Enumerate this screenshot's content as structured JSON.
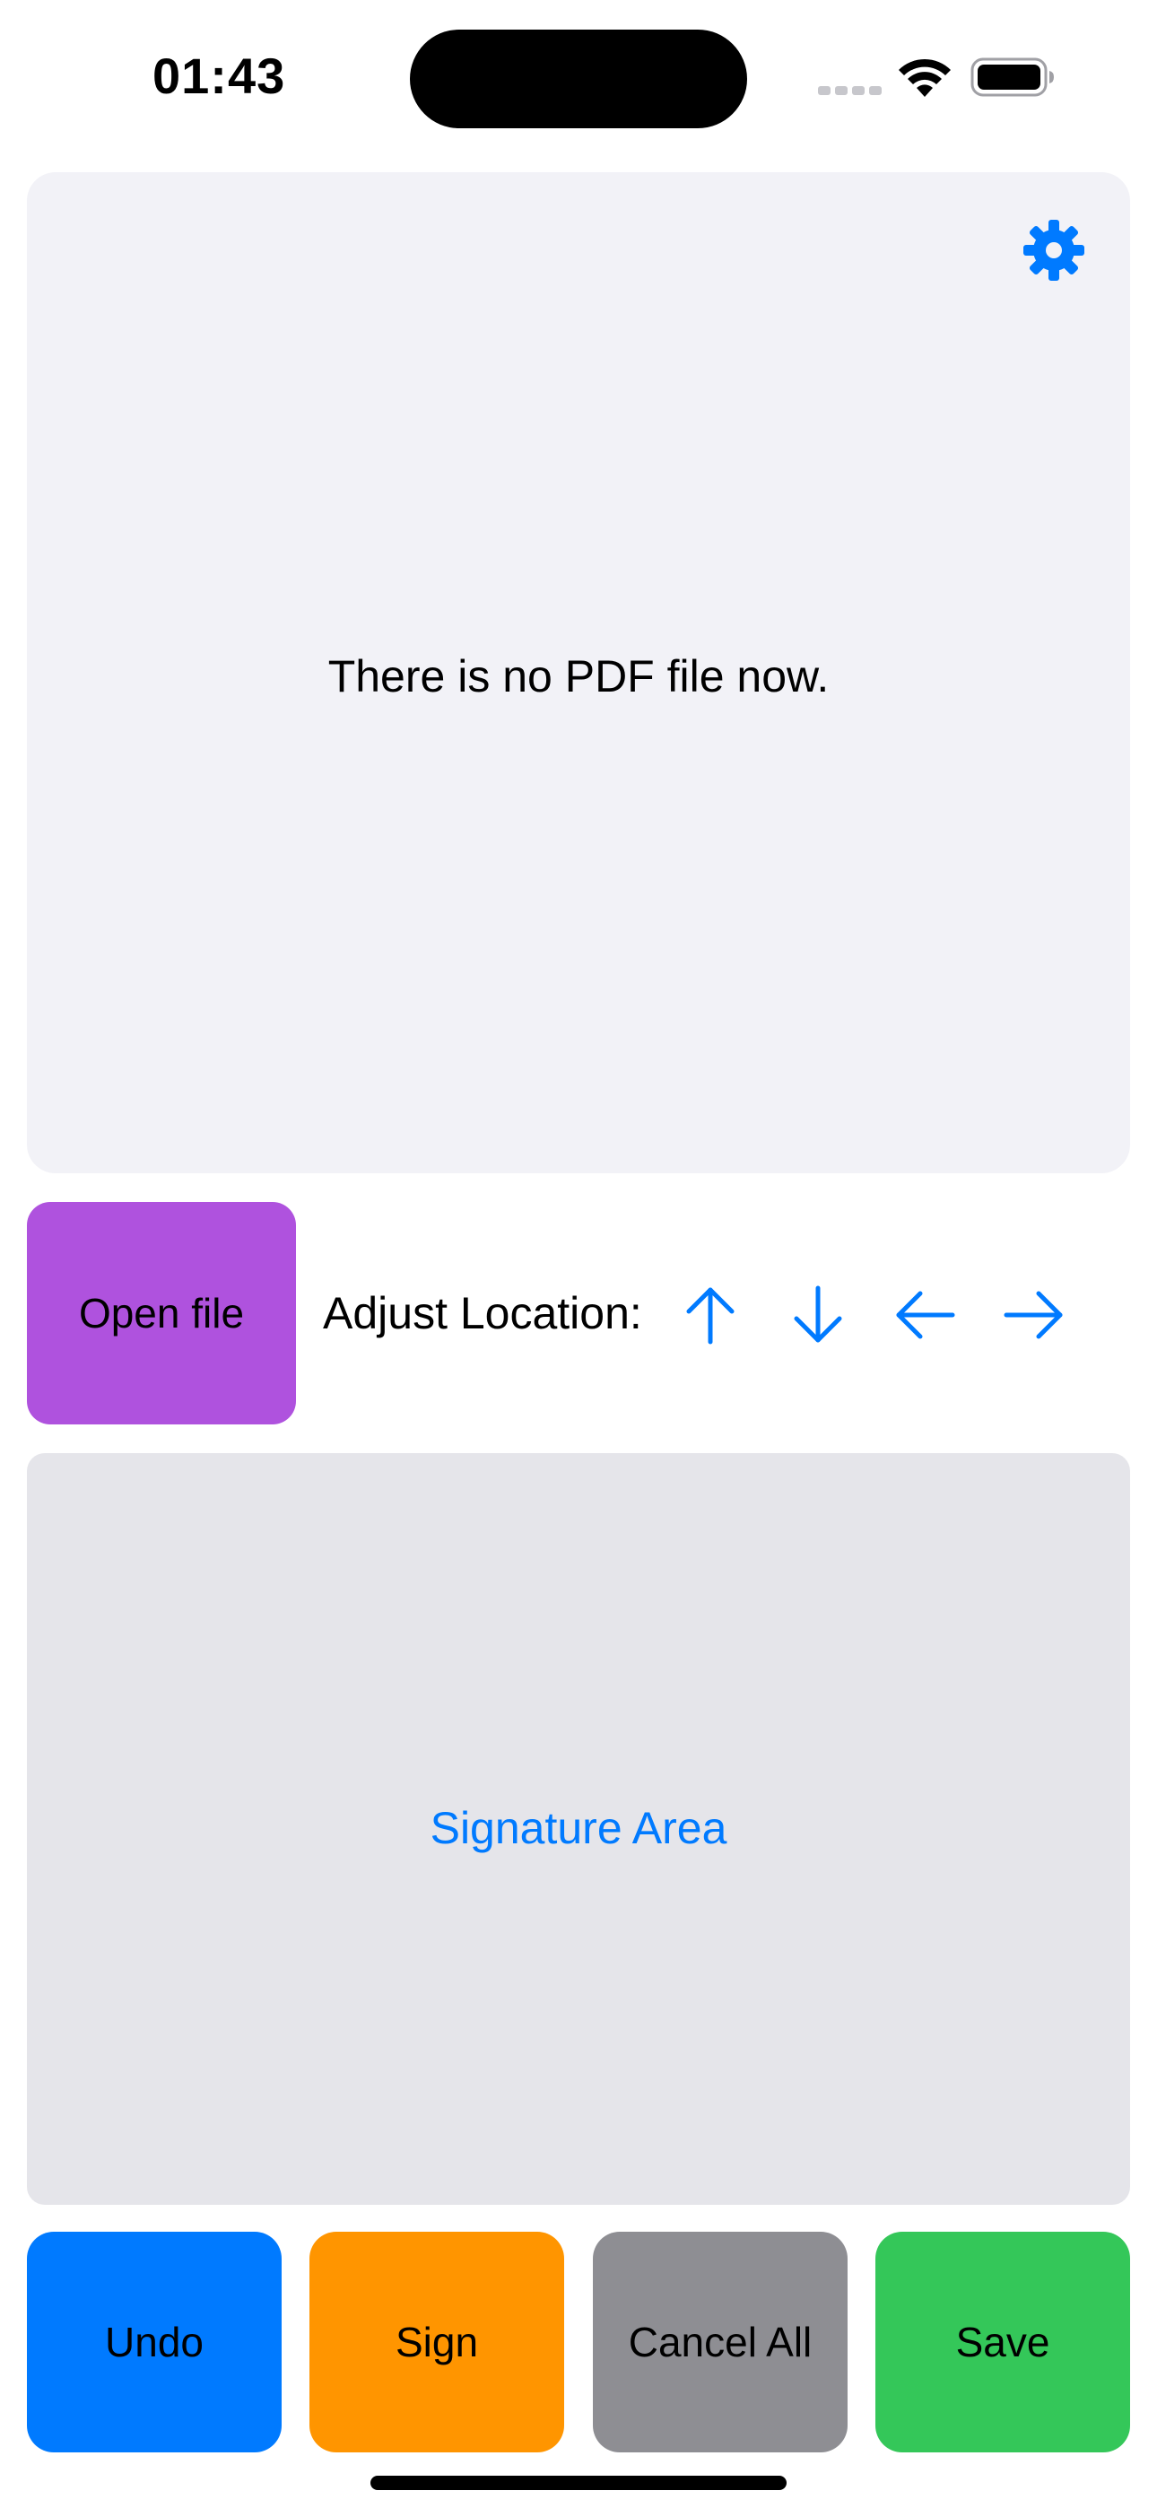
{
  "status_bar": {
    "time": "01:43",
    "icons": [
      "signal-icon",
      "wifi-icon",
      "battery-icon"
    ]
  },
  "pdf_viewer": {
    "empty_message": "There is no PDF file now.",
    "settings_icon": "gear-icon"
  },
  "controls": {
    "open_file_label": "Open file",
    "adjust_location_label": "Adjust Location:",
    "arrows": [
      "arrow-up-icon",
      "arrow-down-icon",
      "arrow-left-icon",
      "arrow-right-icon"
    ]
  },
  "signature": {
    "placeholder": "Signature Area"
  },
  "actions": {
    "undo_label": "Undo",
    "sign_label": "Sign",
    "cancel_all_label": "Cancel All",
    "save_label": "Save"
  },
  "colors": {
    "accent": "#007aff",
    "open_file": "#af52de",
    "undo": "#007aff",
    "sign": "#ff9500",
    "cancel_all": "#8e8e93",
    "save": "#34c759",
    "pdf_panel_bg": "#f2f2f7",
    "signature_bg": "#e5e5ea"
  }
}
